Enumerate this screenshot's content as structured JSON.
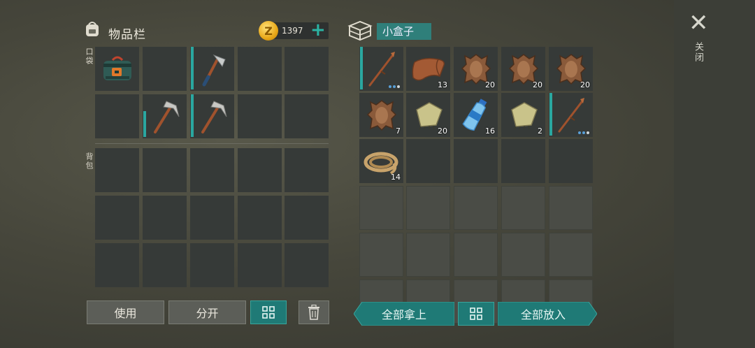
{
  "inventory": {
    "title": "物品栏",
    "pocket_label": "口袋",
    "backpack_label": "背包",
    "coins": "1397",
    "pocket_slots": [
      {
        "item": "backpack-bag",
        "icon": "bag-icon",
        "qty": "",
        "durability": 0
      },
      {
        "item": "",
        "icon": "",
        "qty": "",
        "durability": 0
      },
      {
        "item": "hatchet",
        "icon": "hatchet-icon",
        "qty": "",
        "durability": 1.0
      },
      {
        "item": "",
        "icon": "",
        "qty": "",
        "durability": 0
      },
      {
        "item": "",
        "icon": "",
        "qty": "",
        "durability": 0
      },
      {
        "item": "",
        "icon": "",
        "qty": "",
        "durability": 0
      },
      {
        "item": "pickaxe",
        "icon": "pickaxe-icon",
        "qty": "",
        "durability": 0.6
      },
      {
        "item": "pickaxe",
        "icon": "pickaxe-icon",
        "qty": "",
        "durability": 1.0
      },
      {
        "item": "",
        "icon": "",
        "qty": "",
        "durability": 0
      },
      {
        "item": "",
        "icon": "",
        "qty": "",
        "durability": 0
      }
    ]
  },
  "container": {
    "name": "小盒子",
    "slots": [
      {
        "icon": "spear-icon",
        "qty": "",
        "durability": 1.0,
        "dots": true
      },
      {
        "icon": "leather-icon",
        "qty": "13"
      },
      {
        "icon": "animal-skin-icon",
        "qty": "20"
      },
      {
        "icon": "animal-skin-icon",
        "qty": "20"
      },
      {
        "icon": "animal-skin-icon",
        "qty": "20"
      },
      {
        "icon": "animal-skin-icon",
        "qty": "7"
      },
      {
        "icon": "cloth-icon",
        "qty": "20"
      },
      {
        "icon": "water-bottle-icon",
        "qty": "16"
      },
      {
        "icon": "cloth-icon",
        "qty": "2"
      },
      {
        "icon": "spear-icon",
        "qty": "",
        "durability": 1.0,
        "dots": true
      },
      {
        "icon": "rope-icon",
        "qty": "14"
      }
    ]
  },
  "buttons": {
    "use": "使用",
    "split": "分开",
    "take_all": "全部拿上",
    "put_all": "全部放入",
    "close": "关闭"
  },
  "colors": {
    "accent": "#1f7a76",
    "durability": "#2aa7a0"
  }
}
